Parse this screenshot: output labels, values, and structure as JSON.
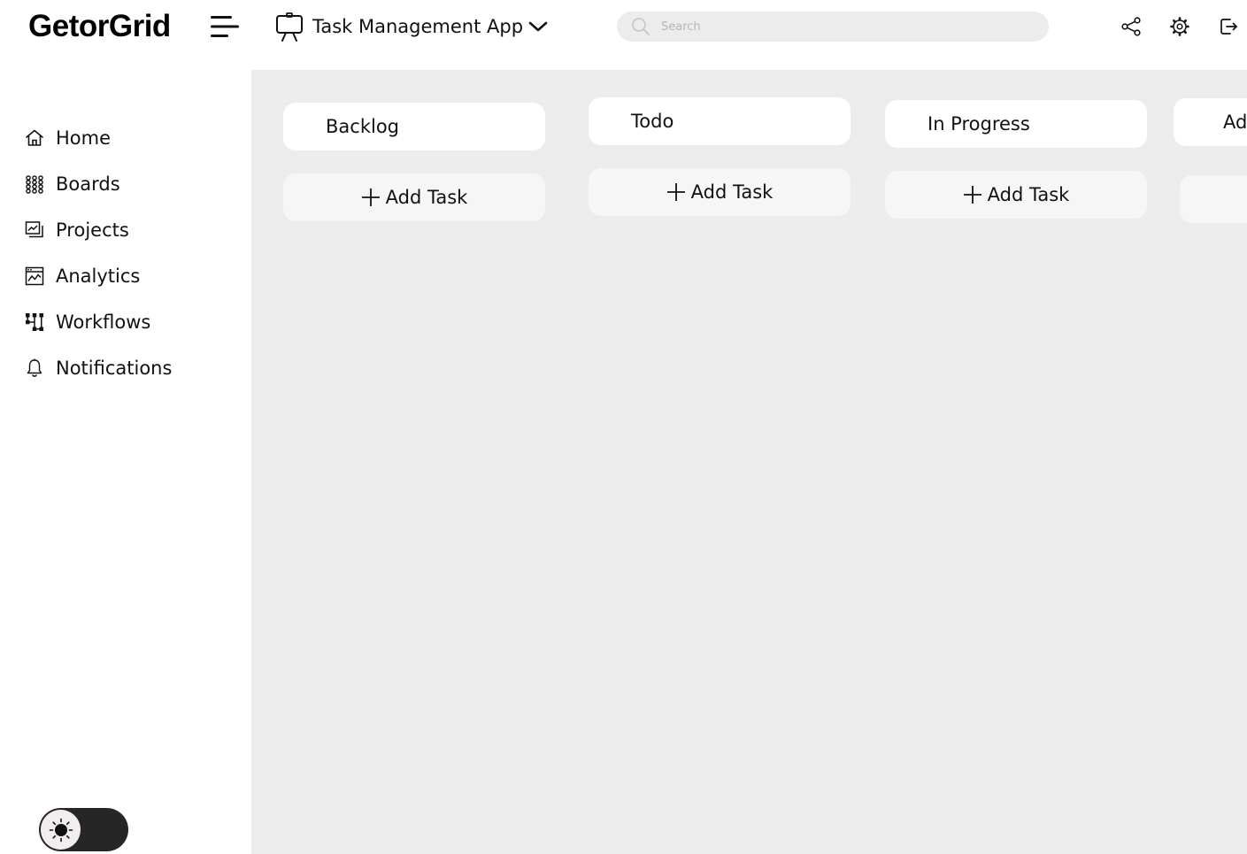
{
  "header": {
    "logo": "GetorGrid",
    "project_title": "Task Management App",
    "search": {
      "placeholder": "Search",
      "value": ""
    },
    "actions": [
      "share-icon",
      "settings-icon",
      "logout-icon"
    ]
  },
  "sidebar": {
    "items": [
      {
        "label": "Home",
        "icon": "home-icon"
      },
      {
        "label": "Boards",
        "icon": "boards-icon"
      },
      {
        "label": "Projects",
        "icon": "projects-icon"
      },
      {
        "label": "Analytics",
        "icon": "analytics-icon"
      },
      {
        "label": "Workflows",
        "icon": "workflows-icon"
      },
      {
        "label": "Notifications",
        "icon": "bell-icon"
      }
    ],
    "theme_toggle": {
      "mode": "light",
      "icon": "sun-icon"
    }
  },
  "board": {
    "columns": [
      {
        "title": "Backlog",
        "add_label": "Add Task"
      },
      {
        "title": "Todo",
        "add_label": "Add Task"
      },
      {
        "title": "In Progress",
        "add_label": "Add Task"
      },
      {
        "title": "Ad",
        "add_label": ""
      }
    ]
  },
  "colors": {
    "board_background": "#ececec",
    "card": "#ffffff",
    "add_button": "#f6f6f6",
    "toggle_track": "#262626",
    "text": "#111111"
  }
}
